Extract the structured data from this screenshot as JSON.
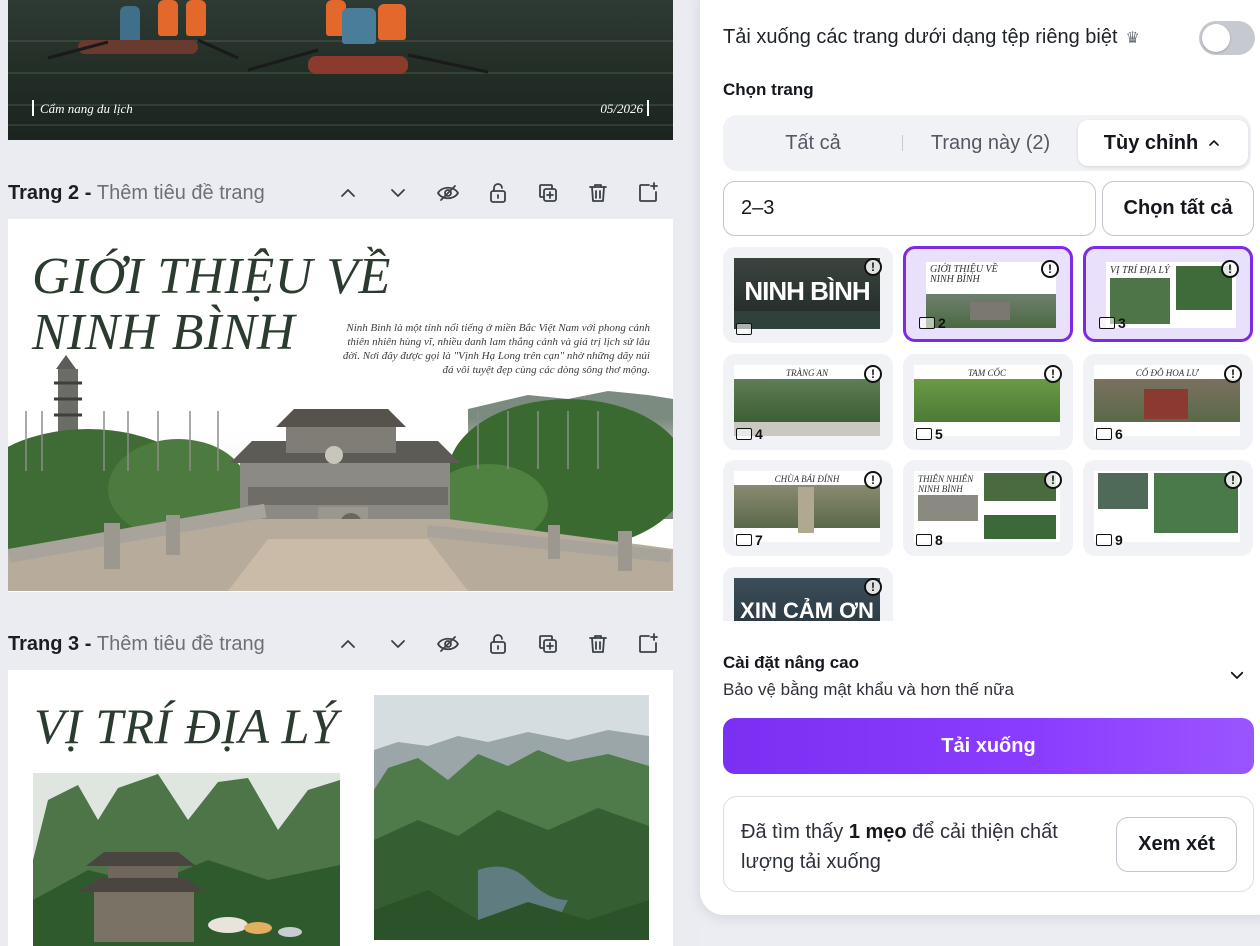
{
  "editor": {
    "page1": {
      "caption_left": "Cẩm nang du lịch",
      "caption_right": "05/2026"
    },
    "page2": {
      "label": "Trang 2 - ",
      "placeholder": "Thêm tiêu đề trang",
      "heading_line1": "GIỚI THIỆU VỀ",
      "heading_line2": "NINH BÌNH",
      "blurb": "Ninh Bình là một tỉnh nổi tiếng ở miền Bắc Việt Nam với phong cảnh thiên nhiên hùng vĩ, nhiều danh lam thắng cảnh và giá trị lịch sử lâu đời. Nơi đây được gọi là \"Vịnh Hạ Long trên cạn\" nhờ những dãy núi đá vôi tuyệt đẹp cùng các dòng sông thơ mộng."
    },
    "page3": {
      "label": "Trang 3 - ",
      "placeholder": "Thêm tiêu đề trang",
      "heading": "VỊ TRÍ ĐỊA LÝ"
    },
    "tool_icons": [
      "chevron-up-icon",
      "chevron-down-icon",
      "eye-hide-icon",
      "lock-icon",
      "duplicate-icon",
      "trash-icon",
      "add-page-icon"
    ]
  },
  "panel": {
    "separate_files_label": "Tải xuống các trang dưới dạng tệp riêng biệt",
    "crown_icon": "♛",
    "separate_files_on": false,
    "select_pages_label": "Chọn trang",
    "tabs": [
      {
        "label": "Tất cả",
        "active": false
      },
      {
        "label": "Trang này (2)",
        "active": false
      },
      {
        "label": "Tùy chỉnh",
        "active": true
      }
    ],
    "range_value": "2–3",
    "select_all_label": "Chọn tất cả",
    "thumbnails": [
      {
        "page": "",
        "title": "NINH BÌNH",
        "selected": false
      },
      {
        "page": "2",
        "title": "GIỚI THIỆU VỀ NINH BÌNH",
        "selected": true
      },
      {
        "page": "3",
        "title": "VỊ TRÍ ĐỊA LÝ",
        "selected": true
      },
      {
        "page": "4",
        "title": "TRÀNG AN",
        "selected": false
      },
      {
        "page": "5",
        "title": "TAM CỐC",
        "selected": false
      },
      {
        "page": "6",
        "title": "CỐ ĐÔ HOA LƯ",
        "selected": false
      },
      {
        "page": "7",
        "title": "CHÙA BÁI ĐÍNH",
        "selected": false
      },
      {
        "page": "8",
        "title": "THIÊN NHIÊN NINH BÌNH",
        "selected": false
      },
      {
        "page": "9",
        "title": "",
        "selected": false
      },
      {
        "page": "",
        "title": "XIN CẢM ƠN",
        "selected": false
      }
    ],
    "advanced_title": "Cài đặt nâng cao",
    "advanced_sub": "Bảo vệ bằng mật khẩu và hơn thế nữa",
    "download_label": "Tải xuống",
    "tip_prefix": "Đã tìm thấy ",
    "tip_bold": "1 mẹo",
    "tip_suffix": " để cải thiện chất lượng tải xuống",
    "review_label": "Xem xét",
    "colors": {
      "accent": "#8b3dff",
      "selected_border": "#7d2ae8"
    }
  }
}
